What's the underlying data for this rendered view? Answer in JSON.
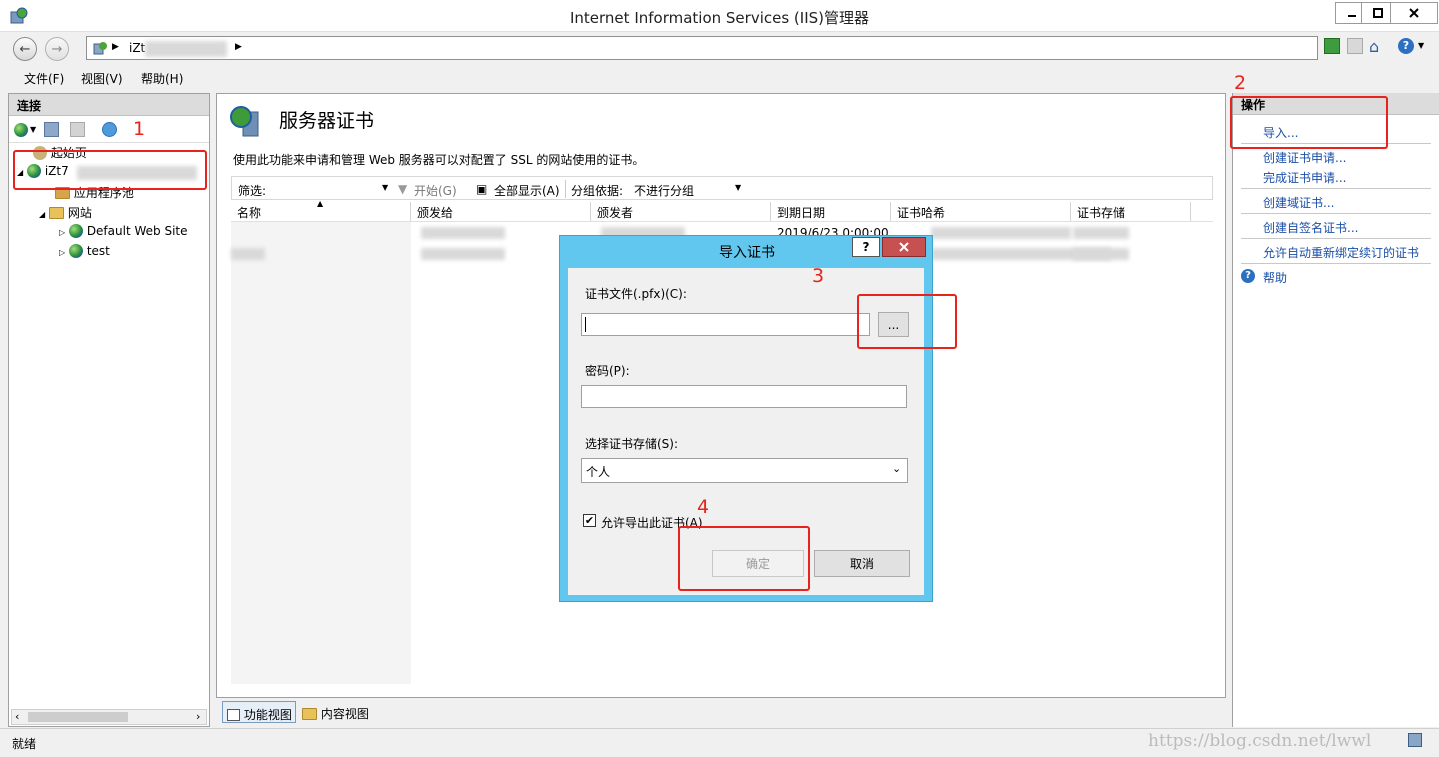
{
  "window": {
    "title": "Internet Information Services (IIS)管理器"
  },
  "address": {
    "path_visible": "iZt"
  },
  "menu": [
    {
      "label": "文件(F)"
    },
    {
      "label": "视图(V)"
    },
    {
      "label": "帮助(H)"
    }
  ],
  "connections": {
    "header": "连接",
    "tree": [
      {
        "label": "起始页"
      },
      {
        "label": "iZt7"
      },
      {
        "label": "应用程序池"
      },
      {
        "label": "网站"
      },
      {
        "label": "Default Web Site"
      },
      {
        "label": "test"
      }
    ]
  },
  "center": {
    "title": "服务器证书",
    "description": "使用此功能来申请和管理 Web 服务器可以对配置了 SSL 的网站使用的证书。",
    "filter_label": "筛选:",
    "start_label": "开始(G)",
    "show_all_label": "全部显示(A)",
    "group_label": "分组依据:",
    "group_value": "不进行分组",
    "columns": [
      "名称",
      "颁发给",
      "颁发者",
      "到期日期",
      "证书哈希",
      "证书存储"
    ],
    "row_expiry": "2019/6/23 0:00:00"
  },
  "actions": {
    "header": "操作",
    "items": [
      {
        "label": "导入..."
      },
      {
        "label": "创建证书申请..."
      },
      {
        "label": "完成证书申请..."
      },
      {
        "label": "创建域证书..."
      },
      {
        "label": "创建自签名证书..."
      },
      {
        "label": "允许自动重新绑定续订的证书"
      },
      {
        "label": "帮助"
      }
    ]
  },
  "view_tabs": {
    "features": "功能视图",
    "content": "内容视图"
  },
  "status": {
    "text": "就绪",
    "watermark": "https://blog.csdn.net/lwwl"
  },
  "dialog": {
    "title": "导入证书",
    "help_glyph": "?",
    "cert_file_label": "证书文件(.pfx)(C):",
    "cert_file_value": "",
    "browse_label": "...",
    "password_label": "密码(P):",
    "password_value": "",
    "store_label": "选择证书存储(S):",
    "store_value": "个人",
    "allow_export_label": "允许导出此证书(A)",
    "allow_export_checked": true,
    "ok_label": "确定",
    "cancel_label": "取消"
  },
  "annotations": {
    "n1": "1",
    "n2": "2",
    "n3": "3",
    "n4": "4",
    "color": "#e8231c"
  }
}
